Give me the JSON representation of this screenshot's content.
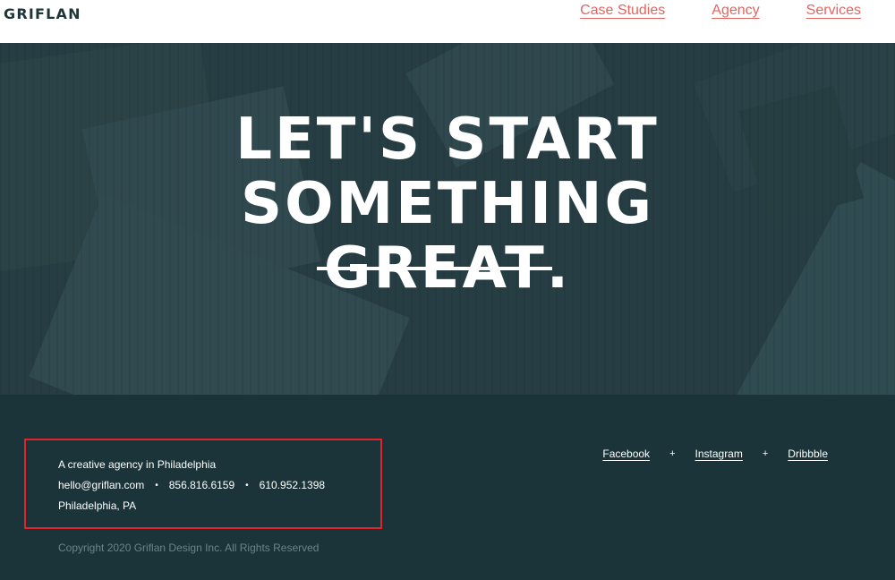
{
  "header": {
    "logo": "GRIFLAN",
    "nav": [
      "Case Studies",
      "Agency",
      "Services"
    ],
    "link_color": "#e26560"
  },
  "hero": {
    "headline_line1": "LET'S START",
    "headline_line2": "SOMETHING",
    "headline_struck": "GREAT",
    "headline_period": "."
  },
  "footer": {
    "tagline": "A creative agency in Philadelphia",
    "email": "hello@griflan.com",
    "phone1": "856.816.6159",
    "phone2": "610.952.1398",
    "separator": "•",
    "location": "Philadelphia, PA",
    "copyright": "Copyright 2020 Griflan Design Inc. All Rights Reserved",
    "social": [
      "Facebook",
      "Instagram",
      "Dribbble"
    ],
    "social_separator": "+",
    "highlight_color": "#e0242a"
  }
}
